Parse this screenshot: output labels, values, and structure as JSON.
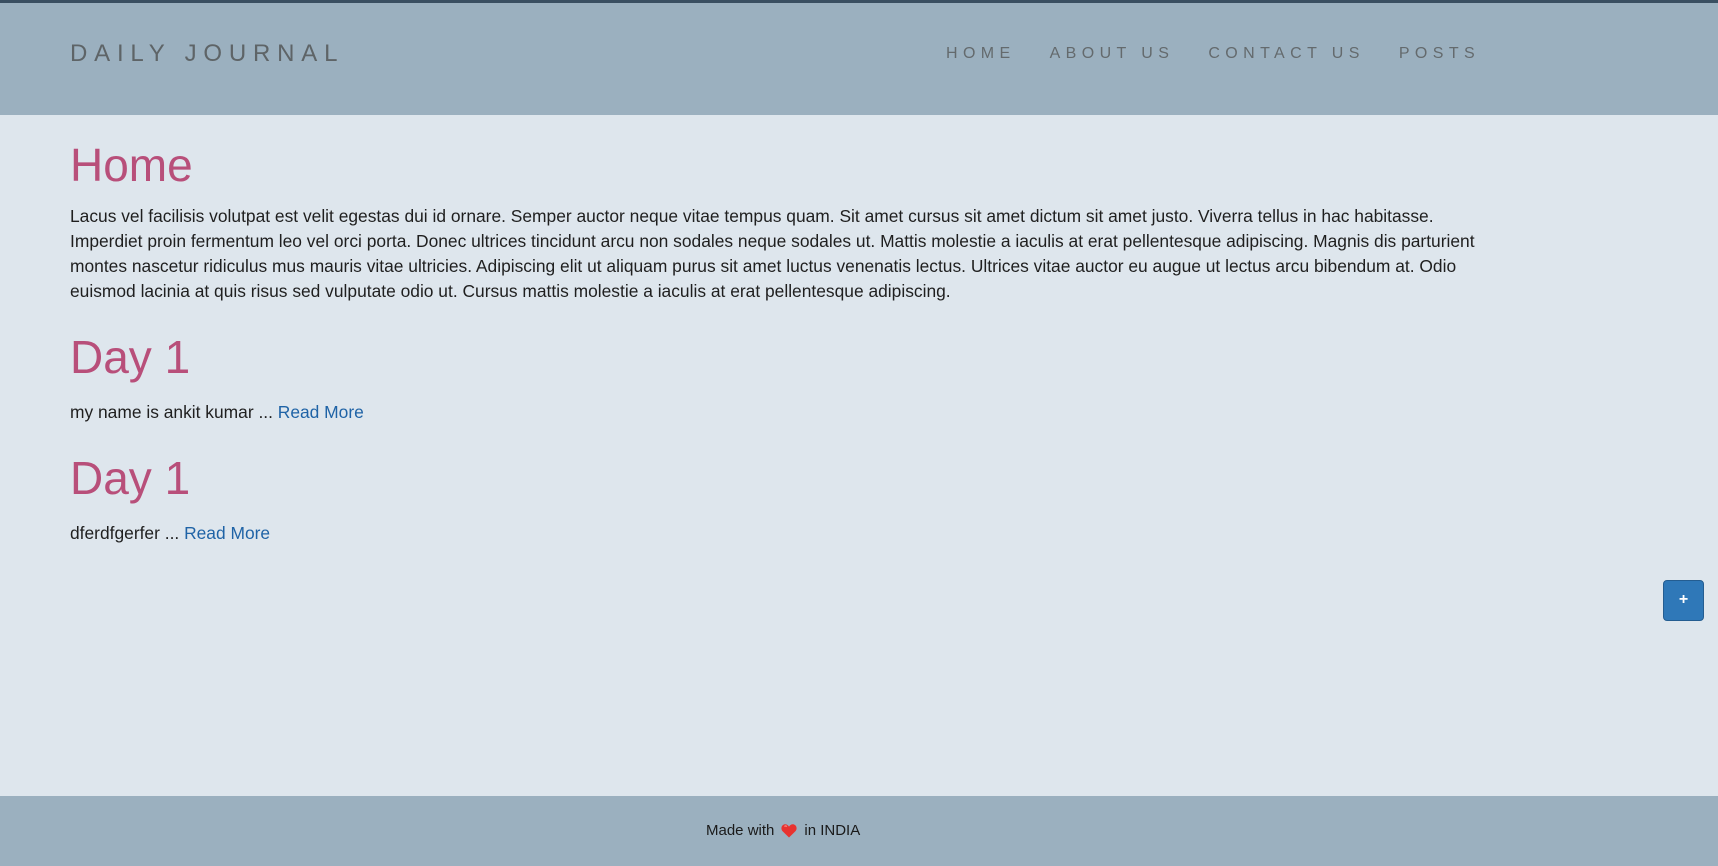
{
  "header": {
    "brand": "DAILY JOURNAL",
    "nav": [
      "HOME",
      "ABOUT US",
      "CONTACT US",
      "POSTS"
    ]
  },
  "main": {
    "title": "Home",
    "intro": "Lacus vel facilisis volutpat est velit egestas dui id ornare. Semper auctor neque vitae tempus quam. Sit amet cursus sit amet dictum sit amet justo. Viverra tellus in hac habitasse. Imperdiet proin fermentum leo vel orci porta. Donec ultrices tincidunt arcu non sodales neque sodales ut. Mattis molestie a iaculis at erat pellentesque adipiscing. Magnis dis parturient montes nascetur ridiculus mus mauris vitae ultricies. Adipiscing elit ut aliquam purus sit amet luctus venenatis lectus. Ultrices vitae auctor eu augue ut lectus arcu bibendum at. Odio euismod lacinia at quis risus sed vulputate odio ut. Cursus mattis molestie a iaculis at erat pellentesque adipiscing.",
    "posts": [
      {
        "title": "Day 1",
        "excerpt": "my name is ankit kumar ... ",
        "link": "Read More"
      },
      {
        "title": "Day 1",
        "excerpt": "dferdfgerfer ... ",
        "link": "Read More"
      }
    ]
  },
  "fab": {
    "label": "+"
  },
  "footer": {
    "before": "Made with",
    "icon": "heart-icon",
    "after": "in INDIA"
  },
  "colors": {
    "navbar": "#9bb0bf",
    "background": "#dee6ed",
    "heading": "#b84f7a",
    "link": "#1f63a6",
    "button": "#2f78b8",
    "heart": "#e8322f"
  }
}
